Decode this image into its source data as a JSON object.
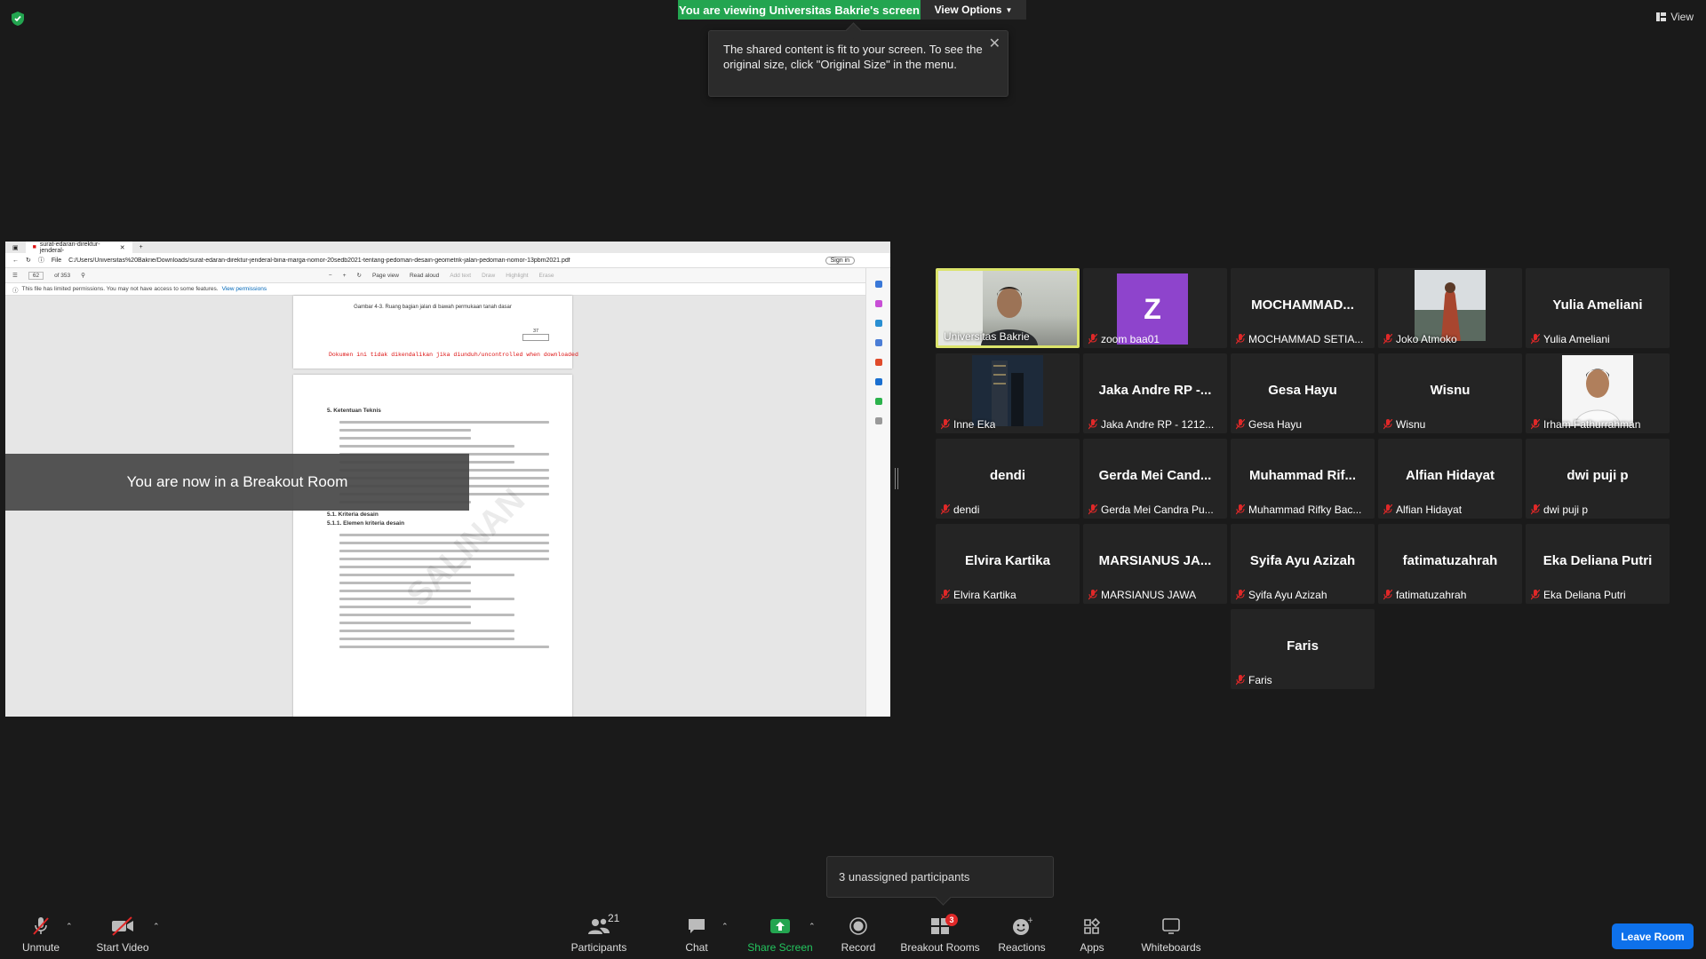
{
  "top": {
    "viewing_banner": "You are viewing Universitas Bakrie's screen",
    "view_options": "View Options",
    "view_label": "View"
  },
  "tooltip": {
    "text": "The shared content is fit to your screen. To see the original size, click \"Original Size\" in the menu."
  },
  "shared_screen": {
    "tab_title": "surat-edaran-direktur-jenderal-",
    "address": "C:/Users/Universitas%20Bakrie/Downloads/surat-edaran-direktur-jenderal-bina-marga-nomor-20sedb2021-tentang-pedoman-desain-geometrik-jalan-pedoman-nomor-13pbm2021.pdf",
    "file_label": "File",
    "sign_in": "Sign in",
    "page_input": "62",
    "page_total": "of 353",
    "pdf_toolbar": [
      "Page view",
      "Read aloud",
      "Add text",
      "Draw",
      "Highlight",
      "Erase"
    ],
    "permission_text": "This file has limited permissions. You may not have access to some features.",
    "permission_link": "View permissions",
    "figure_caption": "Gambar 4-3. Ruang bagian jalan di bawah permukaan tanah dasar",
    "page_number": "37",
    "red_notice": "Dokumen ini tidak dikendalikan jika diunduh/uncontrolled when downloaded",
    "section_heading": "5.     Ketentuan Teknis",
    "subsection_a": "5.1.    Kriteria desain",
    "subsection_b": "5.1.1.  Elemen kriteria desain",
    "watermark": "SALINAN"
  },
  "breakout_banner": "You are now in a Breakout Room",
  "participants": [
    {
      "big": "",
      "label": "Universitas Bakrie",
      "muted": false,
      "kind": "video",
      "active": true
    },
    {
      "big": "Z",
      "label": "zoom baa01",
      "muted": true,
      "kind": "letter"
    },
    {
      "big": "MOCHAMMAD...",
      "label": "MOCHAMMAD SETIA...",
      "muted": true,
      "kind": "name"
    },
    {
      "big": "",
      "label": "Joko Atmoko",
      "muted": true,
      "kind": "photo"
    },
    {
      "big": "Yulia Ameliani",
      "label": "Yulia Ameliani",
      "muted": true,
      "kind": "name"
    },
    {
      "big": "",
      "label": "Inne Eka",
      "muted": true,
      "kind": "photo"
    },
    {
      "big": "Jaka Andre RP -...",
      "label": "Jaka Andre RP - 1212...",
      "muted": true,
      "kind": "name"
    },
    {
      "big": "Gesa Hayu",
      "label": "Gesa Hayu",
      "muted": true,
      "kind": "name"
    },
    {
      "big": "Wisnu",
      "label": "Wisnu",
      "muted": true,
      "kind": "name"
    },
    {
      "big": "",
      "label": "Irham Fathurrahman",
      "muted": true,
      "kind": "photo"
    },
    {
      "big": "dendi",
      "label": "dendi",
      "muted": true,
      "kind": "name"
    },
    {
      "big": "Gerda Mei Cand...",
      "label": "Gerda Mei Candra Pu...",
      "muted": true,
      "kind": "name"
    },
    {
      "big": "Muhammad Rif...",
      "label": "Muhammad Rifky Bac...",
      "muted": true,
      "kind": "name"
    },
    {
      "big": "Alfian Hidayat",
      "label": "Alfian Hidayat",
      "muted": true,
      "kind": "name"
    },
    {
      "big": "dwi puji p",
      "label": "dwi puji p",
      "muted": true,
      "kind": "name"
    },
    {
      "big": "Elvira Kartika",
      "label": "Elvira Kartika",
      "muted": true,
      "kind": "name"
    },
    {
      "big": "MARSIANUS JA...",
      "label": "MARSIANUS JAWA",
      "muted": true,
      "kind": "name"
    },
    {
      "big": "Syifa Ayu Azizah",
      "label": "Syifa Ayu Azizah",
      "muted": true,
      "kind": "name"
    },
    {
      "big": "fatimatuzahrah",
      "label": "fatimatuzahrah",
      "muted": true,
      "kind": "name"
    },
    {
      "big": "Eka Deliana Putri",
      "label": "Eka Deliana Putri",
      "muted": true,
      "kind": "name"
    },
    {
      "big": "Faris",
      "label": "Faris",
      "muted": true,
      "kind": "name"
    }
  ],
  "unassigned_popup": "3 unassigned participants",
  "toolbar": {
    "unmute": "Unmute",
    "start_video": "Start Video",
    "participants": "Participants",
    "participants_count": "21",
    "chat": "Chat",
    "share_screen": "Share Screen",
    "record": "Record",
    "breakout_rooms": "Breakout Rooms",
    "breakout_badge": "3",
    "reactions": "Reactions",
    "apps": "Apps",
    "whiteboards": "Whiteboards",
    "leave_room": "Leave Room"
  },
  "colors": {
    "share_banner": "#23a550",
    "active_speaker": "#dbe46b",
    "leave_button": "#0e71eb",
    "badge": "#e02828"
  }
}
